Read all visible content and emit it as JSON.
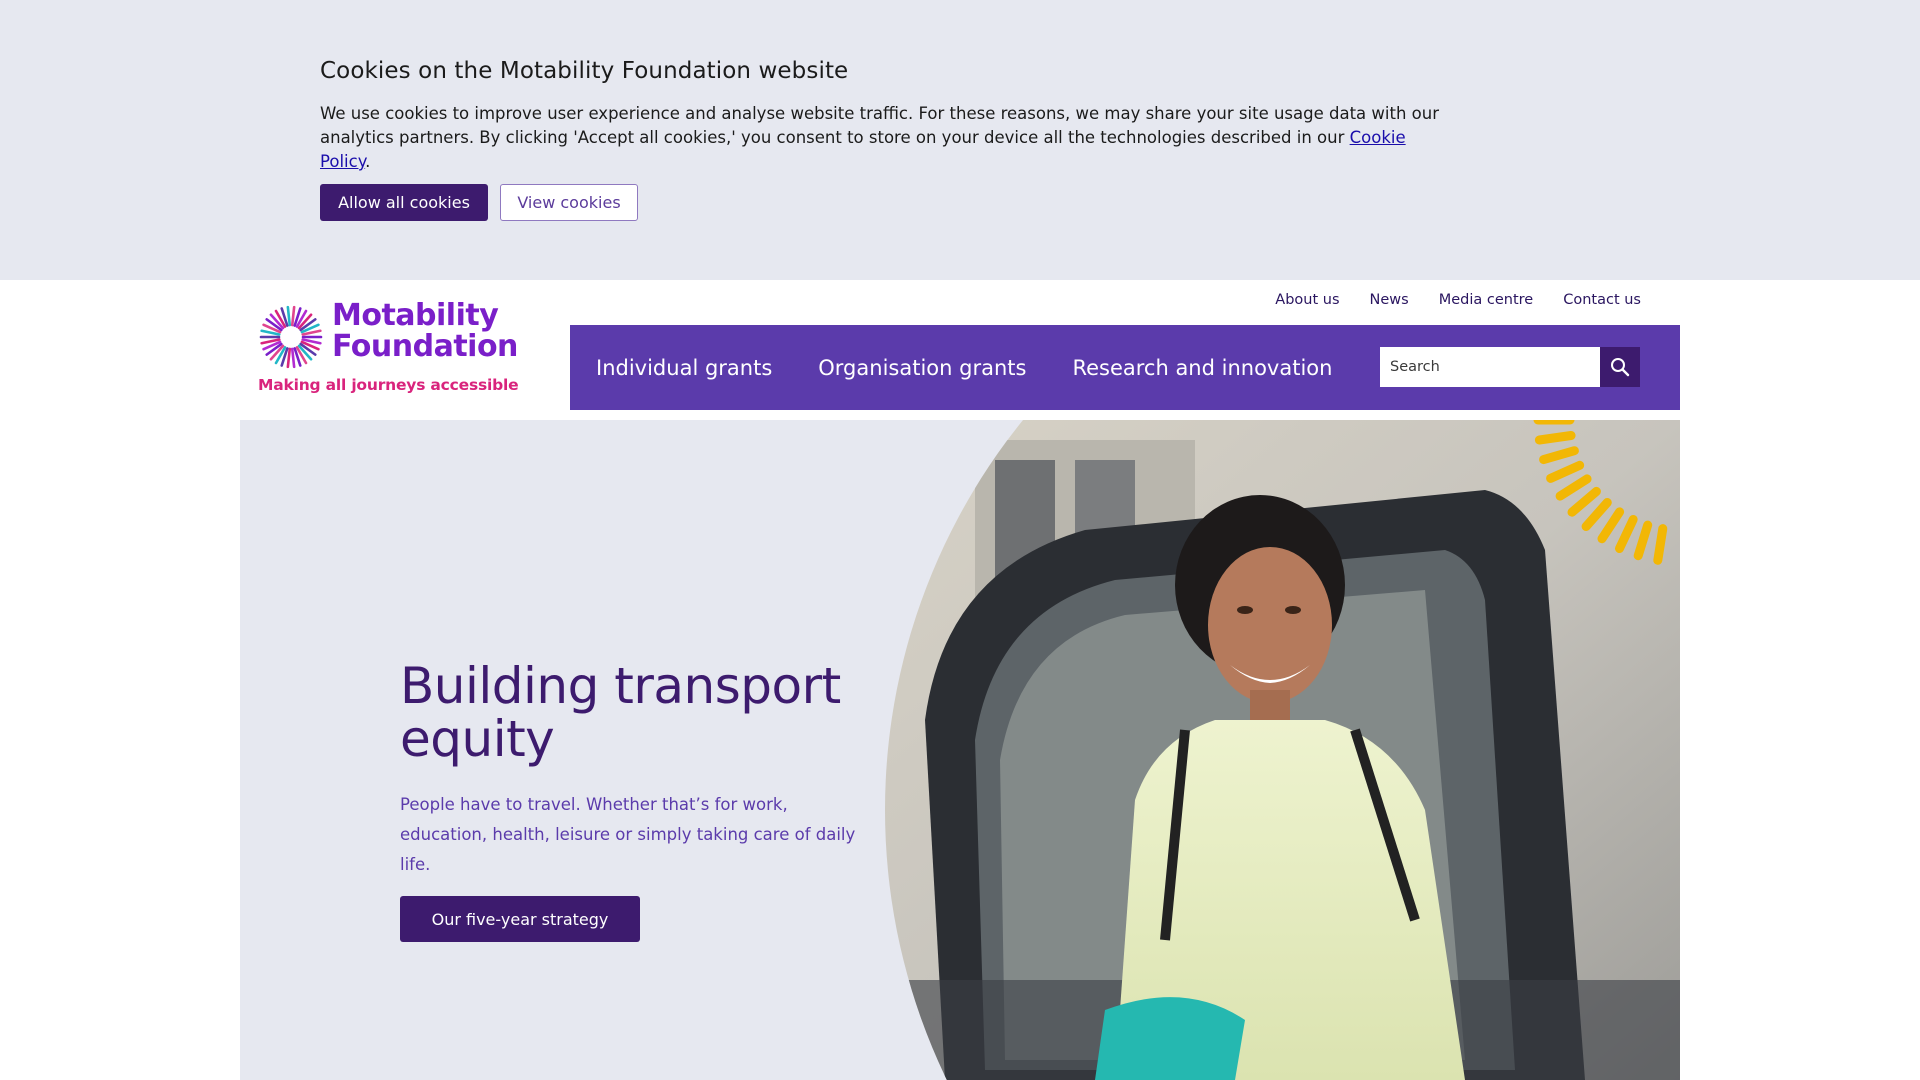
{
  "cookie_banner": {
    "title": "Cookies on the Motability Foundation website",
    "text_before_link": "We use cookies to improve user experience and analyse website traffic. For these reasons, we may share your site usage data with our analytics partners. By clicking 'Accept all cookies,' you consent to store on your device all the technologies described in our ",
    "link_label": "Cookie Policy",
    "text_after_link": ".",
    "allow_label": "Allow all cookies",
    "view_label": "View cookies"
  },
  "header": {
    "logo": {
      "name_line1": "Motability",
      "name_line2": "Foundation",
      "tagline": "Making all journeys accessible"
    },
    "utility_nav": [
      "About us",
      "News",
      "Media centre",
      "Contact us"
    ],
    "main_nav": [
      "Individual grants",
      "Organisation grants",
      "Research and innovation"
    ],
    "search": {
      "placeholder": "Search",
      "icon": "search-icon"
    }
  },
  "hero": {
    "title": "Building transport equity",
    "text": "People have to travel. Whether that’s for work, education, health, leisure or simply taking care of daily life.",
    "cta_label": "Our five-year strategy"
  },
  "colors": {
    "brand_purple": "#3d1b6e",
    "nav_purple": "#5b3bab",
    "logo_purple": "#7a1fc9",
    "tagline_pink": "#d9247d",
    "banner_bg": "#e6e8f0",
    "accent_yellow": "#f2b705"
  }
}
